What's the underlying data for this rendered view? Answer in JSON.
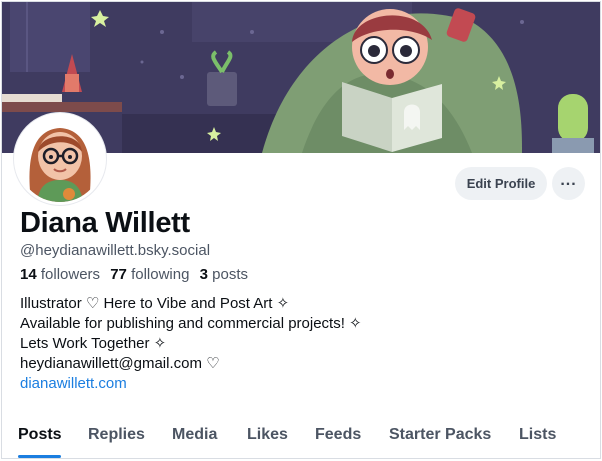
{
  "profile": {
    "name": "Diana Willett",
    "handle": "@heydianawillett.bsky.social",
    "followers_count": "14",
    "followers_label": "followers",
    "following_count": "77",
    "following_label": "following",
    "posts_count": "3",
    "posts_label": "posts"
  },
  "actions": {
    "edit_label": "Edit Profile",
    "more_label": "..."
  },
  "bio": {
    "lines": [
      "Illustrator ♡ Here to Vibe and Post Art ✧",
      "Available for publishing and commercial projects! ✧",
      "Lets Work Together ✧",
      "heydianawillett@gmail.com ♡"
    ],
    "link": "dianawillett.com"
  },
  "tabs": [
    "Posts",
    "Replies",
    "Media",
    "Likes",
    "Feeds",
    "Starter Packs",
    "Lists"
  ],
  "active_tab": "Posts",
  "colors": {
    "accent": "#1b7ee0",
    "banner_bg": "#3e3a5e",
    "button_bg": "#eef1f4"
  },
  "icons": {
    "more": "ellipsis-horizontal-icon"
  }
}
